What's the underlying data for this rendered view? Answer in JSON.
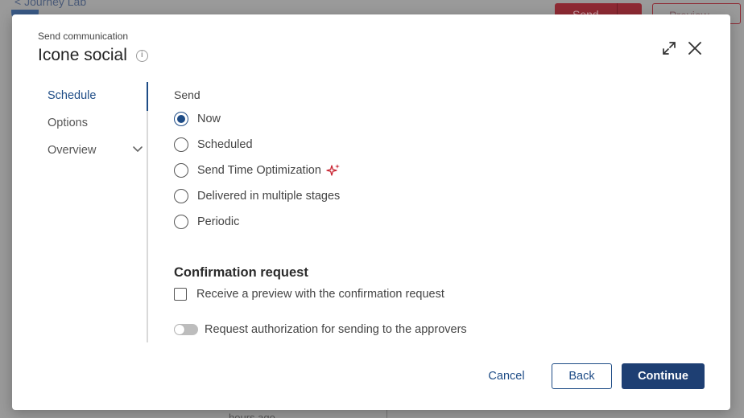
{
  "background": {
    "back_link": "< Journey Lab",
    "send_button": "Send",
    "preview_button": "Preview",
    "hours_text": "hours ago"
  },
  "modal": {
    "subtitle": "Send communication",
    "title": "Icone social",
    "nav": {
      "items": [
        {
          "label": "Schedule",
          "active": true
        },
        {
          "label": "Options",
          "active": false
        },
        {
          "label": "Overview",
          "active": false,
          "expandable": true
        }
      ]
    },
    "send": {
      "label": "Send",
      "options": [
        {
          "label": "Now",
          "checked": true
        },
        {
          "label": "Scheduled",
          "checked": false
        },
        {
          "label": "Send Time Optimization",
          "checked": false,
          "icon": "sparkle-icon"
        },
        {
          "label": "Delivered in multiple stages",
          "checked": false
        },
        {
          "label": "Periodic",
          "checked": false
        }
      ]
    },
    "confirmation": {
      "heading": "Confirmation request",
      "preview_checkbox": {
        "label": "Receive a preview with the confirmation request",
        "checked": false
      },
      "authorization_toggle": {
        "label": "Request authorization for sending to the approvers",
        "on": false
      }
    },
    "footer": {
      "cancel": "Cancel",
      "back": "Back",
      "continue": "Continue"
    }
  },
  "colors": {
    "accent": "#1e4c86",
    "primary_button": "#1e3f73",
    "sparkle": "#c8202e"
  }
}
